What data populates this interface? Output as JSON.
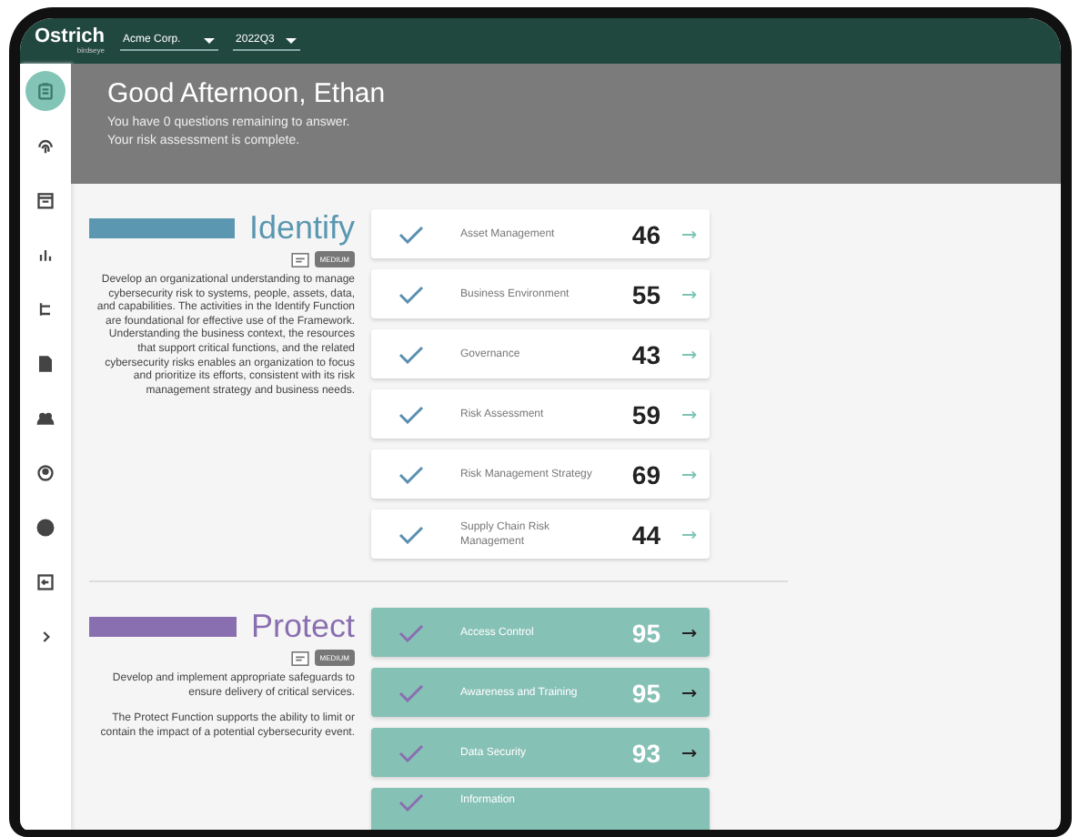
{
  "top_bar": {
    "logo": "Ostrich",
    "logo_sub": "birdseye",
    "company": "Acme Corp.",
    "period": "2022Q3"
  },
  "sidebar": {
    "items": [
      {
        "selected": true
      },
      {
        "selected": false
      },
      {
        "selected": false
      },
      {
        "selected": false
      },
      {
        "selected": false
      },
      {
        "selected": false
      },
      {
        "selected": false
      },
      {
        "selected": false
      },
      {
        "selected": false
      },
      {
        "selected": false
      },
      {
        "selected": false
      }
    ]
  },
  "header": {
    "greeting": "Good Afternoon, Ethan",
    "lines": [
      "You have 0 questions remaining to answer.",
      "Your risk assessment is complete."
    ]
  },
  "sections": [
    {
      "title": "Identify",
      "color": "#5b97b0",
      "kind": "light",
      "badge": "MEDIUM",
      "paragraphs": [
        "Develop an organizational understanding to manage cybersecurity risk to systems, people, assets, data, and capabilities. The activities in the Identify Function are foundational for effective use of the Framework. Understanding the business context, the resources that support critical functions, and the related cybersecurity risks enables an organization to focus and prioritize its efforts, consistent with its risk management strategy and business needs."
      ],
      "categories": [
        {
          "name": "Asset Management",
          "score": "46"
        },
        {
          "name": "Business Environment",
          "score": "55"
        },
        {
          "name": "Governance",
          "score": "43"
        },
        {
          "name": "Risk Assessment",
          "score": "59"
        },
        {
          "name": "Risk Management Strategy",
          "score": "69"
        },
        {
          "name": "Supply Chain Risk Management",
          "score": "44"
        }
      ]
    },
    {
      "title": "Protect",
      "color": "#8a6fb0",
      "kind": "filled",
      "badge": "MEDIUM",
      "paragraphs": [
        "Develop and implement appropriate safeguards to ensure delivery of critical services.",
        "The Protect Function supports the ability to limit or contain the impact of a potential cybersecurity event."
      ],
      "categories": [
        {
          "name": "Access Control",
          "score": "95"
        },
        {
          "name": "Awareness and Training",
          "score": "95"
        },
        {
          "name": "Data Security",
          "score": "93"
        },
        {
          "name": "Information"
        }
      ]
    }
  ]
}
